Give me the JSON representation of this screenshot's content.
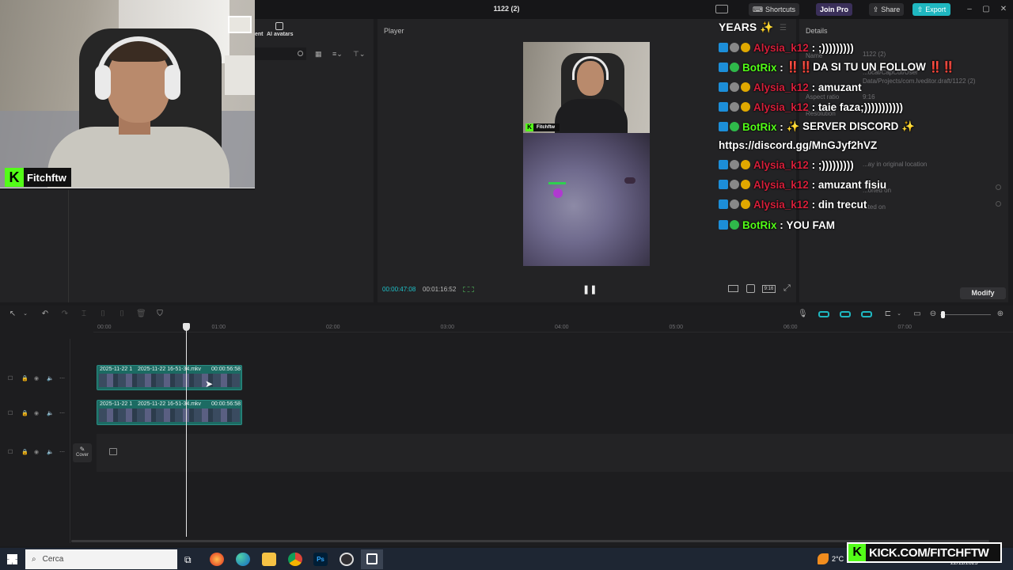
{
  "app": {
    "project_title": "1122 (2)",
    "shortcuts_label": "Shortcuts",
    "join_pro_label": "Join Pro",
    "share_label": "Share",
    "export_label": "Export"
  },
  "left_panel": {
    "tab_partial": "ent",
    "ai_avatars_label": "AI avatars"
  },
  "webcam": {
    "channel_name": "Fitchftw"
  },
  "player": {
    "title": "Player",
    "current_time": "00:00:47:08",
    "total_time": "00:01:16:52",
    "ratio_label": "9:16",
    "preview_channel": "Fitchftw"
  },
  "chat": {
    "header": "YEARS",
    "lines": [
      {
        "user": "Alysia_k12",
        "sep": " : ",
        "msg": ";)))))))))",
        "color": "red"
      },
      {
        "user": "BotRix",
        "sep": " : ",
        "msg": "‼️‼️DA SI TU UN FOLLOW ‼️‼️",
        "color": "green"
      },
      {
        "user": "Alysia_k12",
        "sep": " : ",
        "msg": "amuzant",
        "color": "red"
      },
      {
        "user": "Alysia_k12",
        "sep": " : ",
        "msg": "taie faza;)))))))))))",
        "color": "red"
      },
      {
        "user": "BotRix",
        "sep": " : ",
        "msg": "✨ SERVER DISCORD ✨",
        "color": "green"
      },
      {
        "user": "",
        "sep": "",
        "msg": "https://discord.gg/MnGJyf2hVZ",
        "color": "white"
      },
      {
        "user": "Alysia_k12",
        "sep": " : ",
        "msg": ";)))))))))",
        "color": "red"
      },
      {
        "user": "Alysia_k12",
        "sep": " : ",
        "msg": "amuzant fisiu",
        "color": "red"
      },
      {
        "user": "Alysia_k12",
        "sep": " : ",
        "msg": "din trecut",
        "color": "red"
      },
      {
        "user": "BotRix",
        "sep": " : ",
        "msg": "YOU FAM",
        "color": "green"
      }
    ]
  },
  "details": {
    "title": "Details",
    "name_label": "Name",
    "name_value": "1122 (2)",
    "path_value": "...ocal/CapCut/User Data/Projects/com.lveditor.draft/1122 (2)",
    "aspect_label": "Aspect ratio",
    "aspect_value": "9:16",
    "resolution_label": "Resolution",
    "play_location": "...ay in original location",
    "imported_label": "...orted on",
    "created_label": "...ted on",
    "modify_label": "Modify"
  },
  "timeline": {
    "ruler": [
      "00:00",
      "01:00",
      "02:00",
      "03:00",
      "04:00",
      "05:00",
      "06:00",
      "07:00"
    ],
    "clips": [
      {
        "date": "2025-11-22 1",
        "name": "2025-11-22 16-51-34.mkv",
        "duration": "00:00:56:58"
      },
      {
        "date": "2025-11-22 1",
        "name": "2025-11-22 16-51-34.mkv",
        "duration": "00:00:56:58"
      }
    ],
    "cover_label": "Cover"
  },
  "taskbar": {
    "search_placeholder": "Cerca",
    "temperature": "2°C",
    "date": "22/11/2025"
  },
  "overlay": {
    "kick_url": "KICK.COM/FITCHFTW"
  }
}
